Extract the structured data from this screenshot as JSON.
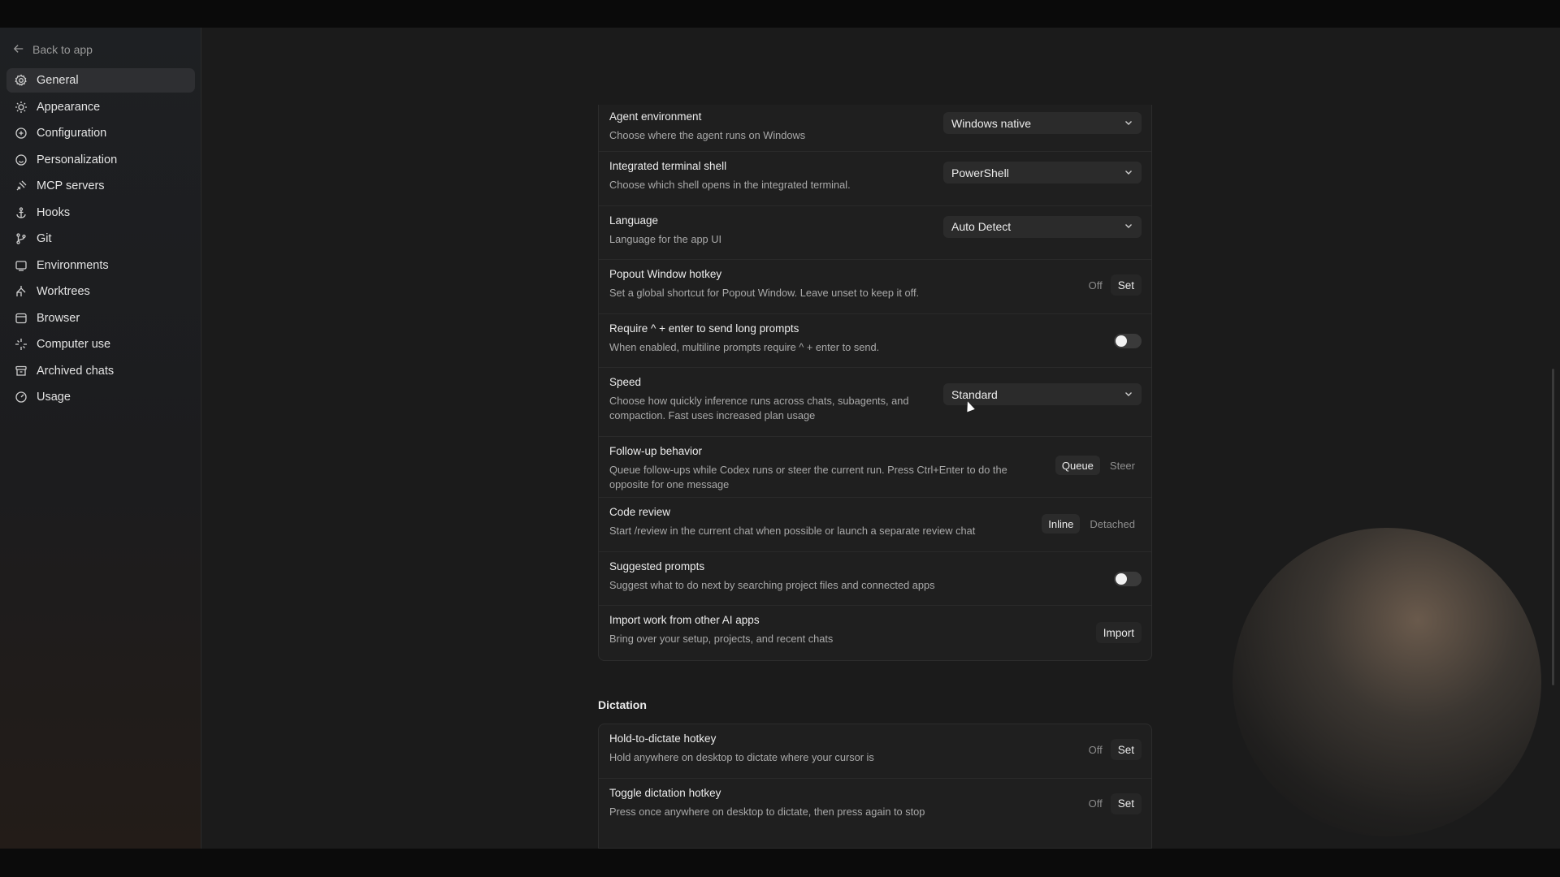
{
  "sidebar": {
    "back_label": "Back to app",
    "items": [
      {
        "label": "General",
        "icon": "gear-icon"
      },
      {
        "label": "Appearance",
        "icon": "sun-icon"
      },
      {
        "label": "Configuration",
        "icon": "config-icon"
      },
      {
        "label": "Personalization",
        "icon": "smile-icon"
      },
      {
        "label": "MCP servers",
        "icon": "plug-icon"
      },
      {
        "label": "Hooks",
        "icon": "anchor-icon"
      },
      {
        "label": "Git",
        "icon": "branch-icon"
      },
      {
        "label": "Environments",
        "icon": "monitor-icon"
      },
      {
        "label": "Worktrees",
        "icon": "tree-icon"
      },
      {
        "label": "Browser",
        "icon": "window-icon"
      },
      {
        "label": "Computer use",
        "icon": "sparkle-icon"
      },
      {
        "label": "Archived chats",
        "icon": "archive-icon"
      },
      {
        "label": "Usage",
        "icon": "gauge-icon"
      }
    ],
    "active_index": 0
  },
  "settings": {
    "agent_environment": {
      "title": "Agent environment",
      "desc": "Choose where the agent runs on Windows",
      "value": "Windows native"
    },
    "terminal_shell": {
      "title": "Integrated terminal shell",
      "desc": "Choose which shell opens in the integrated terminal.",
      "value": "PowerShell"
    },
    "language": {
      "title": "Language",
      "desc": "Language for the app UI",
      "value": "Auto Detect"
    },
    "popout_hotkey": {
      "title": "Popout Window hotkey",
      "desc": "Set a global shortcut for Popout Window. Leave unset to keep it off.",
      "status": "Off",
      "button": "Set"
    },
    "require_enter": {
      "title": "Require ^ + enter to send long prompts",
      "desc": "When enabled, multiline prompts require ^ + enter to send.",
      "enabled": false
    },
    "speed": {
      "title": "Speed",
      "desc": "Choose how quickly inference runs across chats, subagents, and compaction. Fast uses increased plan usage",
      "value": "Standard"
    },
    "follow_up": {
      "title": "Follow-up behavior",
      "desc": "Queue follow-ups while Codex runs or steer the current run. Press Ctrl+Enter to do the opposite for one message",
      "options": [
        "Queue",
        "Steer"
      ],
      "selected": "Queue"
    },
    "code_review": {
      "title": "Code review",
      "desc": "Start /review in the current chat when possible or launch a separate review chat",
      "options": [
        "Inline",
        "Detached"
      ],
      "selected": "Inline"
    },
    "suggested_prompts": {
      "title": "Suggested prompts",
      "desc": "Suggest what to do next by searching project files and connected apps",
      "enabled": false
    },
    "import_work": {
      "title": "Import work from other AI apps",
      "desc": "Bring over your setup, projects, and recent chats",
      "button": "Import"
    }
  },
  "dictation": {
    "section_title": "Dictation",
    "hold_hotkey": {
      "title": "Hold-to-dictate hotkey",
      "desc": "Hold anywhere on desktop to dictate where your cursor is",
      "status": "Off",
      "button": "Set"
    },
    "toggle_hotkey": {
      "title": "Toggle dictation hotkey",
      "desc": "Press once anywhere on desktop to dictate, then press again to stop",
      "status": "Off",
      "button": "Set"
    }
  }
}
